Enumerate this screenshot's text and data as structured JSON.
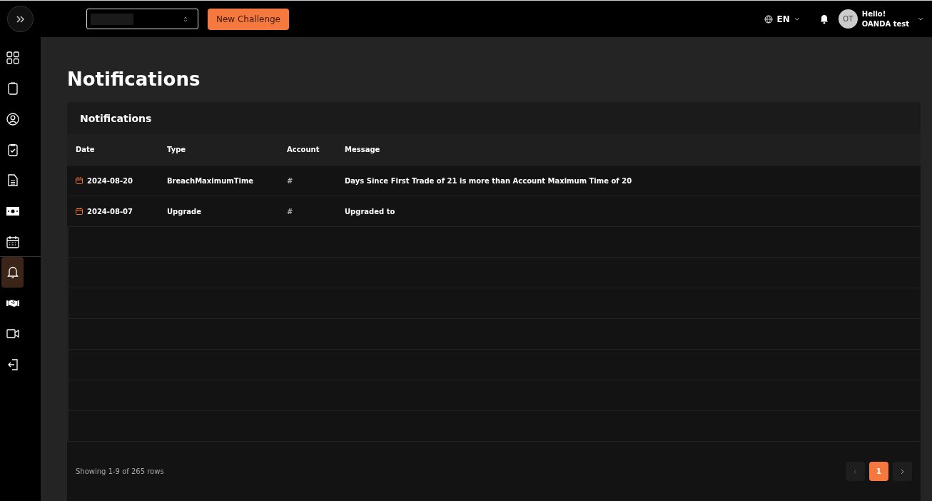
{
  "topbar": {
    "new_button": "New Challenge",
    "language": "EN",
    "user": {
      "initials": "OT",
      "greeting": "Hello!",
      "name": "OANDA test"
    }
  },
  "sidebar": {
    "items": [
      {
        "selected": false
      },
      {
        "selected": false
      },
      {
        "selected": false
      },
      {
        "selected": false
      },
      {
        "selected": false
      },
      {
        "selected": false
      },
      {
        "selected": false
      },
      {
        "selected": true
      },
      {
        "selected": false
      },
      {
        "selected": false
      },
      {
        "selected": false
      }
    ]
  },
  "page_title": "Notifications",
  "card": {
    "title": "Notifications",
    "table": {
      "columns": [
        "Date",
        "Type",
        "Account",
        "Message"
      ],
      "rows": [
        {
          "date": "2024-08-20",
          "type": "BreachMaximumTime",
          "account": "#",
          "message": "Days Since First Trade of 21 is more than Account Maximum Time of 20"
        },
        {
          "date": "2024-08-07",
          "type": "Upgrade",
          "account": "#",
          "message": "Upgraded to"
        }
      ]
    },
    "footer": "Showing 1-9 of 265 rows",
    "pagination": [
      {
        "label": "1",
        "selected": true
      }
    ]
  }
}
